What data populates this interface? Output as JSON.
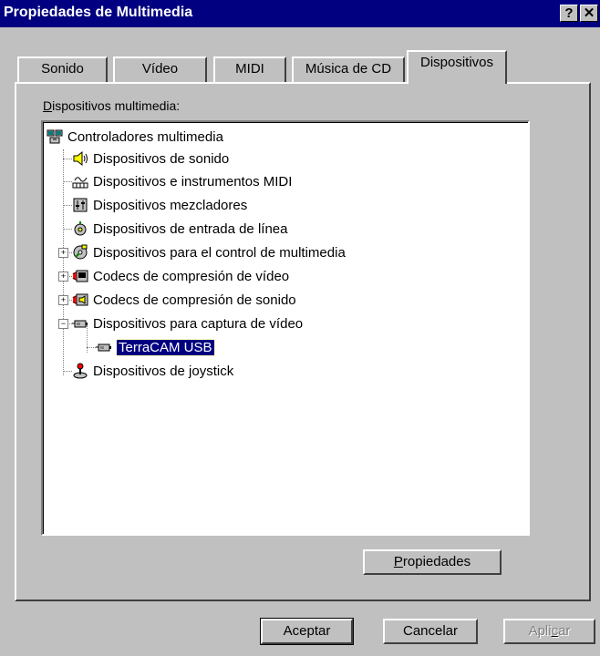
{
  "window": {
    "title": "Propiedades de Multimedia",
    "help_glyph": "?",
    "close_glyph": "✕"
  },
  "tabs": [
    {
      "label": "Sonido"
    },
    {
      "label": "Vídeo"
    },
    {
      "label": "MIDI"
    },
    {
      "label": "Música de CD"
    },
    {
      "label": "Dispositivos",
      "active": true
    }
  ],
  "devices_label": {
    "mnemonic": "D",
    "rest": "ispositivos multimedia:"
  },
  "tree": {
    "root": {
      "label": "Controladores multimedia",
      "icon": "multimedia-controllers-icon"
    },
    "items": [
      {
        "label": "Dispositivos de sonido",
        "icon": "speaker-icon",
        "expandable": false
      },
      {
        "label": "Dispositivos e instrumentos MIDI",
        "icon": "midi-icon",
        "expandable": false
      },
      {
        "label": "Dispositivos mezcladores",
        "icon": "mixer-icon",
        "expandable": false
      },
      {
        "label": "Dispositivos de entrada de línea",
        "icon": "line-input-icon",
        "expandable": false
      },
      {
        "label": "Dispositivos para el control de multimedia",
        "icon": "media-control-icon",
        "expandable": true,
        "expanded": false
      },
      {
        "label": "Codecs de compresión de vídeo",
        "icon": "video-codec-icon",
        "expandable": true,
        "expanded": false
      },
      {
        "label": "Codecs de compresión de sonido",
        "icon": "audio-codec-icon",
        "expandable": true,
        "expanded": false
      },
      {
        "label": "Dispositivos para captura de vídeo",
        "icon": "capture-device-icon",
        "expandable": true,
        "expanded": true
      },
      {
        "label": "TerraCAM USB",
        "icon": "webcam-icon",
        "child": true,
        "selected": true
      },
      {
        "label": "Dispositivos de joystick",
        "icon": "joystick-icon",
        "expandable": false
      }
    ],
    "expand_glyph": "+",
    "collapse_glyph": "−"
  },
  "buttons": {
    "properties": {
      "mnemonic": "P",
      "rest": "ropiedades"
    },
    "accept": "Aceptar",
    "cancel": "Cancelar",
    "apply": {
      "before": "Apli",
      "mnemonic": "c",
      "after": "ar"
    }
  },
  "colors": {
    "titlebar": "#000080",
    "face": "#c0c0c0",
    "selection": "#000080"
  }
}
